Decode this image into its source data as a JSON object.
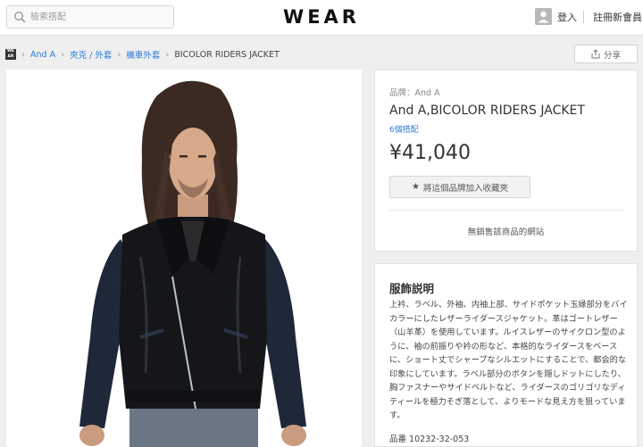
{
  "header": {
    "search_placeholder": "檢索搭配",
    "logo": "WEAR",
    "login": "登入",
    "register": "註冊新會員"
  },
  "breadcrumb": {
    "home_icon_text": "WEAR",
    "items": [
      "And A",
      "夾克 / 外套",
      "機車外套"
    ],
    "current": "BICOLOR RIDERS JACKET"
  },
  "share": {
    "label": "分享"
  },
  "product": {
    "brand": "品牌：And A",
    "title": "And A,BICOLOR RIDERS JACKET",
    "coordinates": "6個搭配",
    "price": "¥41,040",
    "favorite_label": "將這個品牌加入收藏夾",
    "no_store": "無銷售該商品的網站"
  },
  "description": {
    "title": "服飾説明",
    "body": "上衿、ラベル、外袖、内袖上部、サイドポケット玉縁部分をバイカラーにしたレザーライダースジャケット。革はゴートレザー（山羊革）を使用しています。ルイスレザーのサイクロン型のように、袖の前振りや衿の形など、本格的なライダースをベースに、ショート丈でシャープなシルエットにすることで、都会的な印象にしています。ラベル部分のボタンを隠しドットにしたり、胸ファスナーやサイドベルトなど、ライダースのゴリゴリなディティールを極力そぎ落として、よりモードな見え方を狙っています。",
    "sku": "品番 10232-32-053"
  },
  "colors": {
    "link": "#2b7bd6",
    "background": "#efefef"
  }
}
